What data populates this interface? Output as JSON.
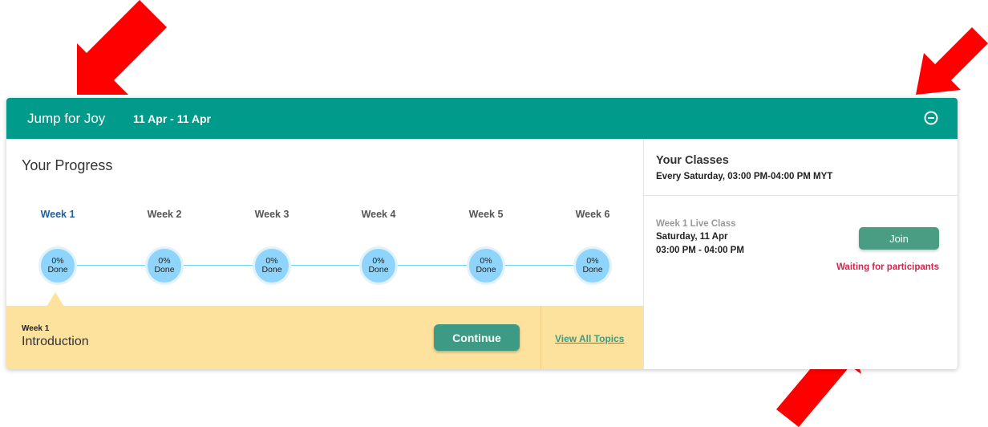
{
  "colors": {
    "header_bg": "#009b8a",
    "accent_button": "#3d9a84",
    "topic_bar_bg": "#fde29d",
    "progress_circle": "#8fd4fb",
    "active_week": "#1f5fa0",
    "waiting_text": "#d6254d",
    "annotation_arrow": "#ff0000"
  },
  "header": {
    "course_title": "Jump for Joy",
    "date_range": "11 Apr - 11 Apr",
    "collapse_icon": "minus-circle-icon"
  },
  "progress": {
    "title": "Your Progress",
    "weeks": [
      {
        "label": "Week 1",
        "percent": "0%",
        "status": "Done",
        "active": true
      },
      {
        "label": "Week 2",
        "percent": "0%",
        "status": "Done",
        "active": false
      },
      {
        "label": "Week 3",
        "percent": "0%",
        "status": "Done",
        "active": false
      },
      {
        "label": "Week 4",
        "percent": "0%",
        "status": "Done",
        "active": false
      },
      {
        "label": "Week 5",
        "percent": "0%",
        "status": "Done",
        "active": false
      },
      {
        "label": "Week 6",
        "percent": "0%",
        "status": "Done",
        "active": false
      }
    ]
  },
  "current_topic": {
    "week": "Week 1",
    "name": "Introduction",
    "continue_label": "Continue",
    "view_all_label": "View All Topics"
  },
  "classes": {
    "title": "Your Classes",
    "schedule": "Every Saturday, 03:00 PM-04:00 PM MYT",
    "live_class": {
      "title": "Week 1 Live Class",
      "date": "Saturday, 11 Apr",
      "time": "03:00 PM - 04:00 PM",
      "join_label": "Join",
      "status": "Waiting for participants"
    }
  }
}
